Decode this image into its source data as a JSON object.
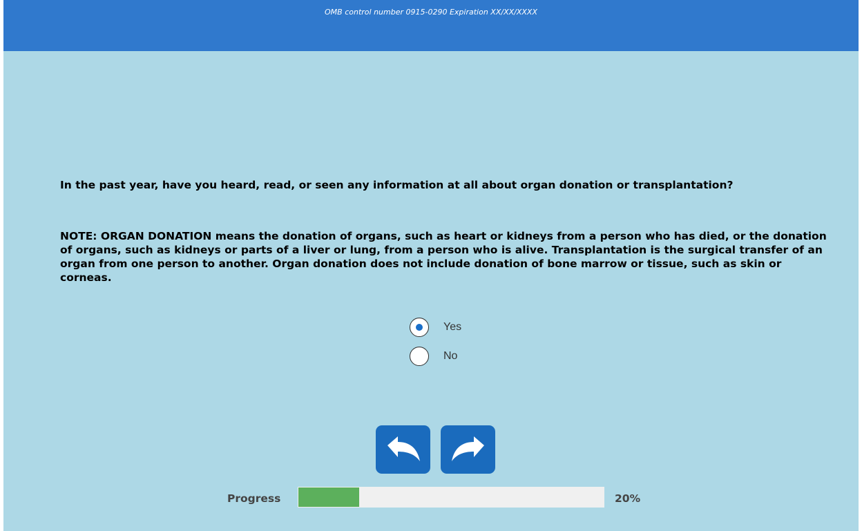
{
  "header": {
    "omb_text": "OMB control number 0915-0290 Expiration XX/XX/XXXX"
  },
  "question": {
    "text": "In the past year, have you heard, read, or seen any information at all about organ donation or transplantation?",
    "note": "NOTE: ORGAN DONATION means the donation of organs, such as heart or kidneys from a person who has died, or the donation of organs, such as kidneys or parts of a liver or lung, from a person who is alive. Transplantation is the surgical transfer of an organ from one person to another. Organ donation does not include donation of bone marrow or tissue, such as skin or corneas."
  },
  "options": [
    {
      "label": "Yes",
      "selected": true
    },
    {
      "label": "No",
      "selected": false
    }
  ],
  "navigation": {
    "back_icon": "back-arrow-icon",
    "next_icon": "forward-arrow-icon"
  },
  "progress": {
    "label": "Progress",
    "value_text": "20%",
    "fraction": 0.2
  },
  "colors": {
    "header": "#3079cd",
    "background": "#add8e6",
    "nav_button": "#1a6bbd",
    "progress_fill": "#5cb05c",
    "radio_dot": "#1a6fc9"
  }
}
